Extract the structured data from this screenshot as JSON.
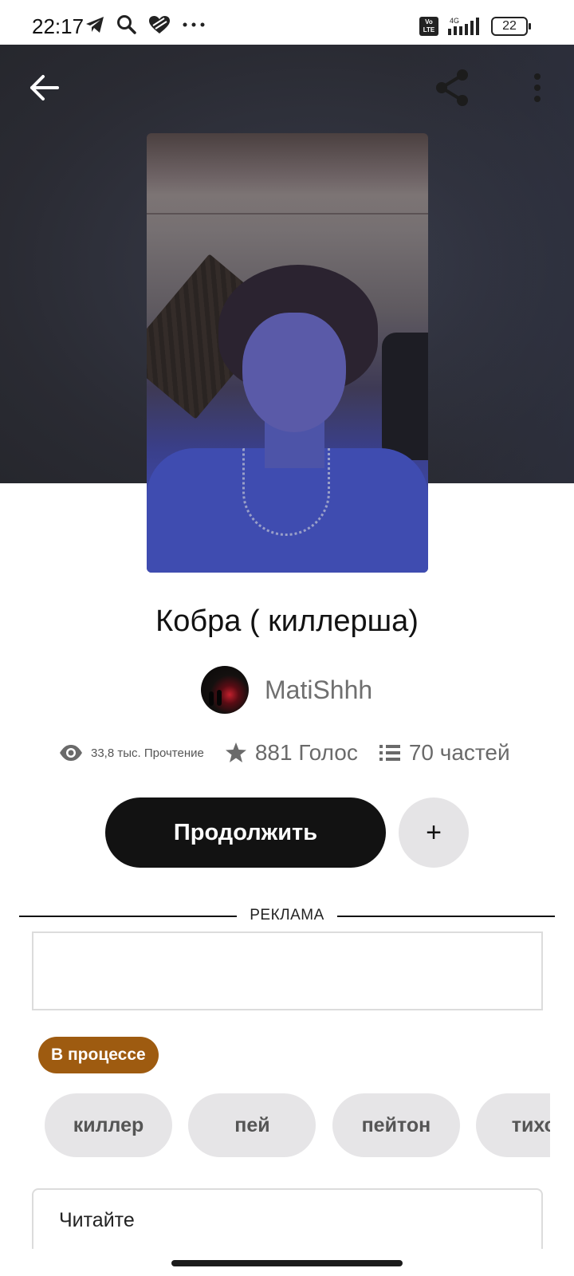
{
  "status_bar": {
    "time": "22:17",
    "network": "4G",
    "battery": "22"
  },
  "icons": {
    "back": "arrow-left-icon",
    "share": "share-icon",
    "more": "more-vertical-icon",
    "views": "eye-icon",
    "votes": "star-icon",
    "parts": "list-icon"
  },
  "story": {
    "title": "Кобра ( киллерша)",
    "author": "MatiShhh",
    "reads": "33,8 тыс. Прочтение",
    "votes": "881 Голос",
    "parts": "70 частей",
    "status": "В процессе"
  },
  "actions": {
    "continue_label": "Продолжить",
    "add_label": "+"
  },
  "ad": {
    "label": "РЕКЛАМА"
  },
  "tags": [
    "киллер",
    "пей",
    "пейтон",
    "тихон"
  ],
  "read_section": {
    "title": "Читайте"
  },
  "colors": {
    "status_badge": "#9e5b10",
    "primary_button": "#121212",
    "tag_background": "#e6e5e7"
  }
}
